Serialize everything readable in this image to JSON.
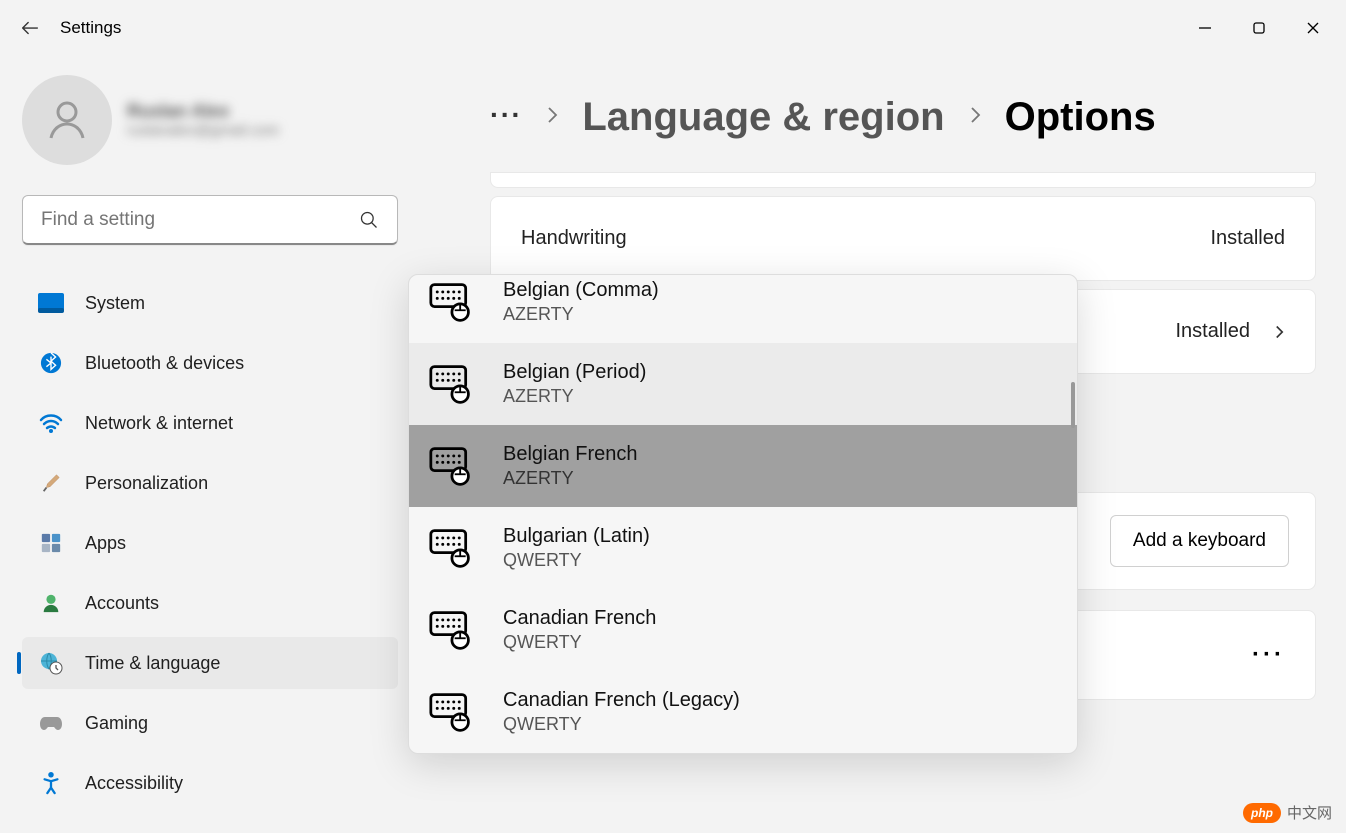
{
  "app_title": "Settings",
  "user": {
    "name": "Ruslan Alex",
    "email": "ruslanalex@gmail.com"
  },
  "search": {
    "placeholder": "Find a setting"
  },
  "sidebar": {
    "items": [
      {
        "label": "System"
      },
      {
        "label": "Bluetooth & devices"
      },
      {
        "label": "Network & internet"
      },
      {
        "label": "Personalization"
      },
      {
        "label": "Apps"
      },
      {
        "label": "Accounts"
      },
      {
        "label": "Time & language"
      },
      {
        "label": "Gaming"
      },
      {
        "label": "Accessibility"
      }
    ]
  },
  "breadcrumb": {
    "parent": "Language & region",
    "current": "Options"
  },
  "cards": {
    "handwriting": {
      "label": "Handwriting",
      "status": "Installed"
    },
    "secondary": {
      "status": "Installed"
    }
  },
  "add_keyboard_label": "Add a keyboard",
  "keyboard_dropdown": {
    "items": [
      {
        "name": "Belgian (Comma)",
        "layout": "AZERTY"
      },
      {
        "name": "Belgian (Period)",
        "layout": "AZERTY"
      },
      {
        "name": "Belgian French",
        "layout": "AZERTY"
      },
      {
        "name": "Bulgarian (Latin)",
        "layout": "QWERTY"
      },
      {
        "name": "Canadian French",
        "layout": "QWERTY"
      },
      {
        "name": "Canadian French (Legacy)",
        "layout": "QWERTY"
      }
    ],
    "selected_index": 2
  },
  "watermark": {
    "badge": "php",
    "text": "中文网"
  }
}
